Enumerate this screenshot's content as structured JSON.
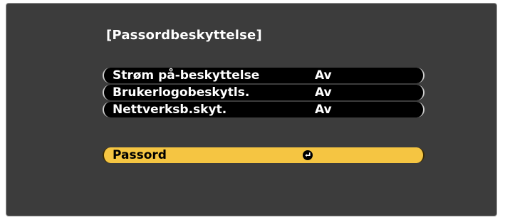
{
  "screen": {
    "title": "[Passordbeskyttelse]"
  },
  "menu": {
    "items": [
      {
        "label": "Strøm på-beskyttelse",
        "value": "Av"
      },
      {
        "label": "Brukerlogobeskytls.",
        "value": "Av"
      },
      {
        "label": "Nettverksb.skyt.",
        "value": "Av"
      }
    ],
    "selected_item": {
      "label": "Passord",
      "icon": "enter-icon"
    }
  },
  "colors": {
    "panel_background": "#3c3c3c",
    "row_background": "#000000",
    "selected_background": "#f5c542",
    "text": "#ffffff",
    "selected_text": "#000000"
  }
}
